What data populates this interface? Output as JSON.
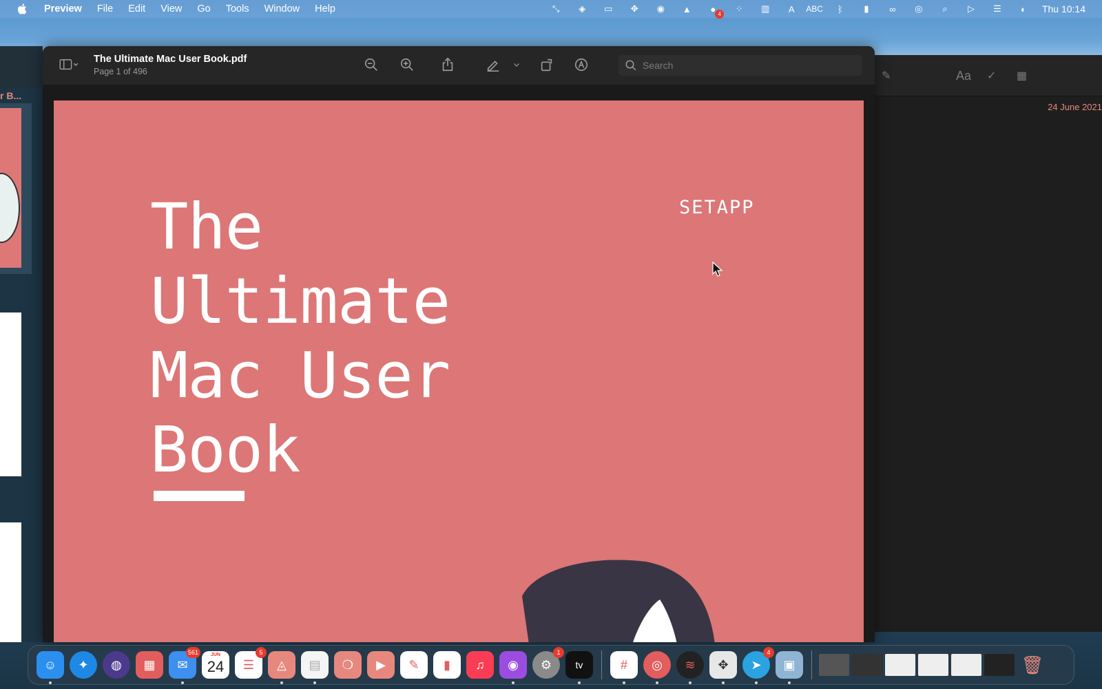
{
  "menubar": {
    "app_name": "Preview",
    "items": [
      "File",
      "Edit",
      "View",
      "Go",
      "Tools",
      "Window",
      "Help"
    ],
    "input_source": "ABC",
    "notification_count": "4",
    "clock": "Thu 10:14"
  },
  "left_window": {
    "title": "r B..."
  },
  "preview": {
    "doc_title": "The Ultimate Mac User Book.pdf",
    "page_info": "Page 1 of 496",
    "search_placeholder": "Search",
    "page": {
      "title_lines": [
        "The",
        "Ultimate",
        "Mac User",
        "Book"
      ],
      "brand": "SETAPP",
      "background_color": "#dd7676"
    }
  },
  "notes": {
    "date": "24 June 2021",
    "format_label": "Aa"
  },
  "dock": {
    "apps": [
      {
        "name": "Finder",
        "color": "#2b8ff0"
      },
      {
        "name": "Safari",
        "color": "#1e88e5"
      },
      {
        "name": "Siri",
        "color": "#4b3a8c"
      },
      {
        "name": "Launchpad",
        "color": "#e25d5d"
      },
      {
        "name": "Mail",
        "color": "#3d8ff0",
        "badge": "561"
      },
      {
        "name": "Calendar",
        "color": "#ffffff",
        "month": "JUN",
        "day": "24"
      },
      {
        "name": "Reminders",
        "color": "#ffffff",
        "badge": "5"
      },
      {
        "name": "Maps",
        "color": "#e7887e"
      },
      {
        "name": "Notes",
        "color": "#f5f5f5"
      },
      {
        "name": "Messages",
        "color": "#e7887e"
      },
      {
        "name": "FaceTime",
        "color": "#e7887e"
      },
      {
        "name": "Scripts",
        "color": "#ffffff"
      },
      {
        "name": "Numbers",
        "color": "#ffffff"
      },
      {
        "name": "Music",
        "color": "#fa3d55"
      },
      {
        "name": "Podcasts",
        "color": "#9b4de0"
      },
      {
        "name": "System Preferences",
        "color": "#8a8a8a",
        "badge": "1"
      },
      {
        "name": "TV",
        "color": "#111111",
        "label": "tv"
      },
      {
        "name": "Slack",
        "color": "#ffffff"
      },
      {
        "name": "Chrome",
        "color": "#e25d5d"
      },
      {
        "name": "Spotify",
        "color": "#222222"
      },
      {
        "name": "Setapp",
        "color": "#e7e7e7"
      },
      {
        "name": "Telegram",
        "color": "#2aa3e0",
        "badge": "4"
      },
      {
        "name": "Preview",
        "color": "#8fb4d4"
      }
    ],
    "trash_label": "Trash"
  },
  "colors": {
    "accent": "#e7887e",
    "cover": "#dd7676",
    "toolbar": "#262626"
  }
}
